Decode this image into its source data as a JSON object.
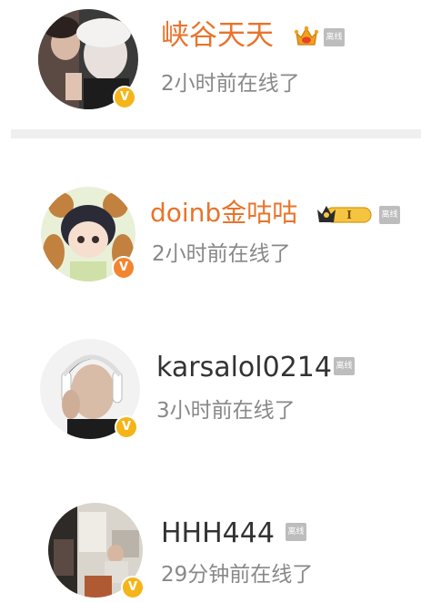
{
  "users": [
    {
      "name": "峡谷天天",
      "status": "2小时前在线了",
      "offline_label": "离线",
      "name_color": "#e8742c",
      "verified_badge": "V",
      "verified_color": "#f5b519",
      "level_icon": "crown-icon"
    },
    {
      "name": "doinb金咕咕",
      "status": "2小时前在线了",
      "offline_label": "离线",
      "name_color": "#e8742c",
      "verified_badge": "V",
      "verified_color": "#f2852f",
      "level_icon": "crown-level-badge-icon",
      "level_text": "I"
    },
    {
      "name": "karsalol0214",
      "status": "3小时前在线了",
      "offline_label": "离线",
      "name_color": "#333333",
      "verified_badge": "V",
      "verified_color": "#f5b519"
    },
    {
      "name": "HHH444",
      "status": "29分钟前在线了",
      "offline_label": "离线",
      "name_color": "#333333",
      "verified_badge": "V",
      "verified_color": "#f5b519"
    }
  ]
}
